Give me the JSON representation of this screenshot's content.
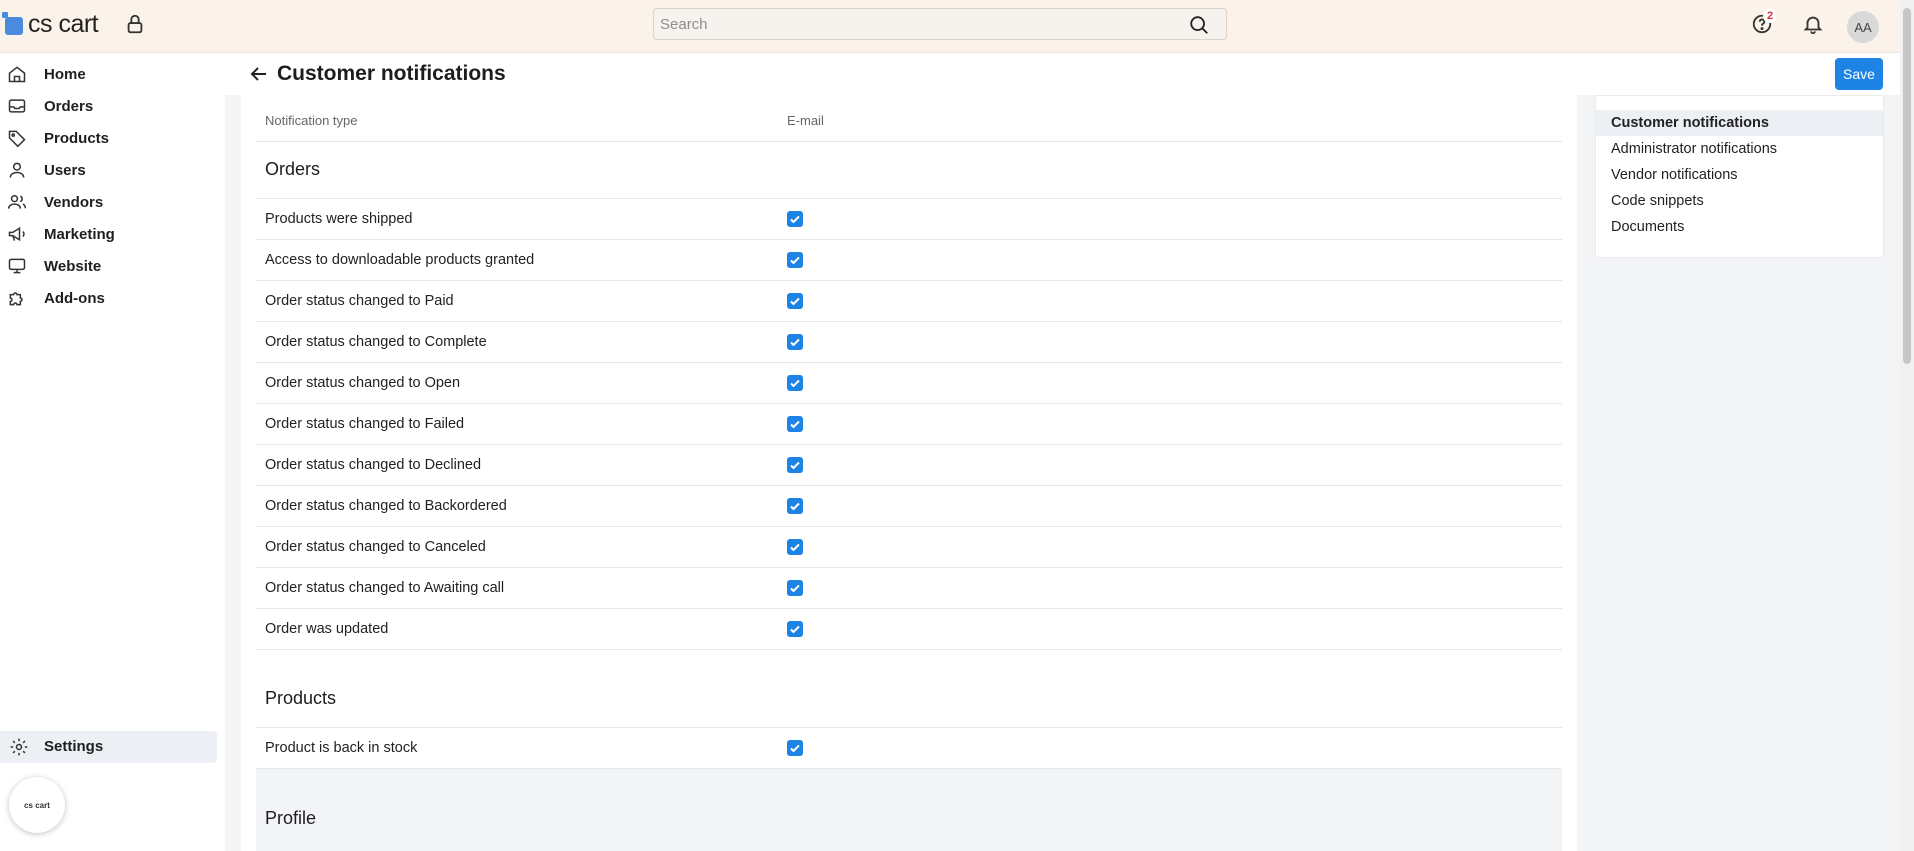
{
  "app": {
    "logo_text": "cs cart"
  },
  "topbar": {
    "search_placeholder": "Search",
    "help_badge": "2",
    "avatar_initials": "AA"
  },
  "sidebar": {
    "items": [
      {
        "label": "Home",
        "icon": "home-icon"
      },
      {
        "label": "Orders",
        "icon": "inbox-icon"
      },
      {
        "label": "Products",
        "icon": "tag-icon"
      },
      {
        "label": "Users",
        "icon": "user-icon"
      },
      {
        "label": "Vendors",
        "icon": "users-icon"
      },
      {
        "label": "Marketing",
        "icon": "megaphone-icon"
      },
      {
        "label": "Website",
        "icon": "monitor-icon"
      },
      {
        "label": "Add-ons",
        "icon": "puzzle-icon"
      }
    ],
    "settings_label": "Settings",
    "mini_logo_text": "cs cart"
  },
  "header": {
    "title": "Customer notifications",
    "save_label": "Save"
  },
  "table": {
    "col_type": "Notification type",
    "col_email": "E-mail",
    "sections": [
      {
        "title": "Orders",
        "rows": [
          {
            "label": "Products were shipped",
            "email": true
          },
          {
            "label": "Access to downloadable products granted",
            "email": true
          },
          {
            "label": "Order status changed to Paid",
            "email": true
          },
          {
            "label": "Order status changed to Complete",
            "email": true
          },
          {
            "label": "Order status changed to Open",
            "email": true
          },
          {
            "label": "Order status changed to Failed",
            "email": true
          },
          {
            "label": "Order status changed to Declined",
            "email": true
          },
          {
            "label": "Order status changed to Backordered",
            "email": true
          },
          {
            "label": "Order status changed to Canceled",
            "email": true
          },
          {
            "label": "Order status changed to Awaiting call",
            "email": true
          },
          {
            "label": "Order was updated",
            "email": true
          }
        ]
      },
      {
        "title": "Products",
        "rows": [
          {
            "label": "Product is back in stock",
            "email": true
          }
        ]
      },
      {
        "title": "Profile",
        "rows": []
      }
    ]
  },
  "side_panel": {
    "items": [
      {
        "label": "Customer notifications",
        "active": true
      },
      {
        "label": "Administrator notifications",
        "active": false
      },
      {
        "label": "Vendor notifications",
        "active": false
      },
      {
        "label": "Code snippets",
        "active": false
      },
      {
        "label": "Documents",
        "active": false
      }
    ]
  },
  "colors": {
    "accent": "#1d84e5",
    "topbar_bg": "#fbf3ea",
    "badge": "#d33333"
  }
}
